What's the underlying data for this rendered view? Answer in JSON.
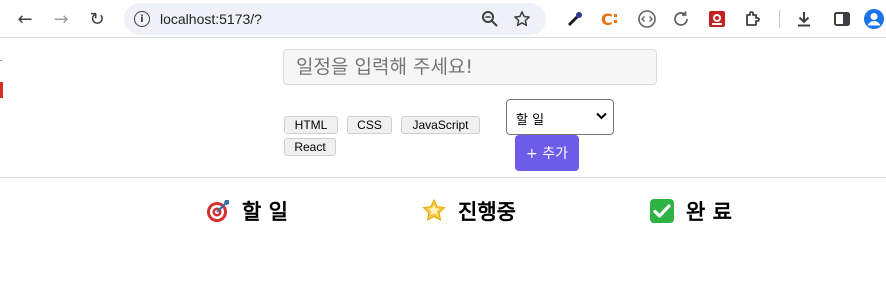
{
  "browser": {
    "url": "localhost:5173/?",
    "nav": {
      "back_glyph": "←",
      "forward_glyph": "→",
      "reload_glyph": "↻"
    },
    "icons": [
      "info-icon",
      "zoom-icon",
      "bookmark-star-icon",
      "eyedropper-extension-icon",
      "c-extension-icon",
      "code-extension-icon",
      "refresh-extension-icon",
      "red-extension-icon",
      "puzzle-extensions-icon",
      "download-icon",
      "side-panel-icon",
      "profile-icon"
    ]
  },
  "form": {
    "placeholder": "일정을 입력해 주세요!",
    "tags": [
      "HTML",
      "CSS",
      "JavaScript",
      "React"
    ],
    "status_selected": "할 일",
    "add_label": "+ 추가"
  },
  "columns": [
    {
      "title": "할 일",
      "icon": "dart-target-icon"
    },
    {
      "title": "진행중",
      "icon": "glowing-star-icon"
    },
    {
      "title": "완 료",
      "icon": "check-mark-icon"
    }
  ],
  "colors": {
    "accent": "#6c5ce7",
    "check_green": "#2fb344"
  }
}
